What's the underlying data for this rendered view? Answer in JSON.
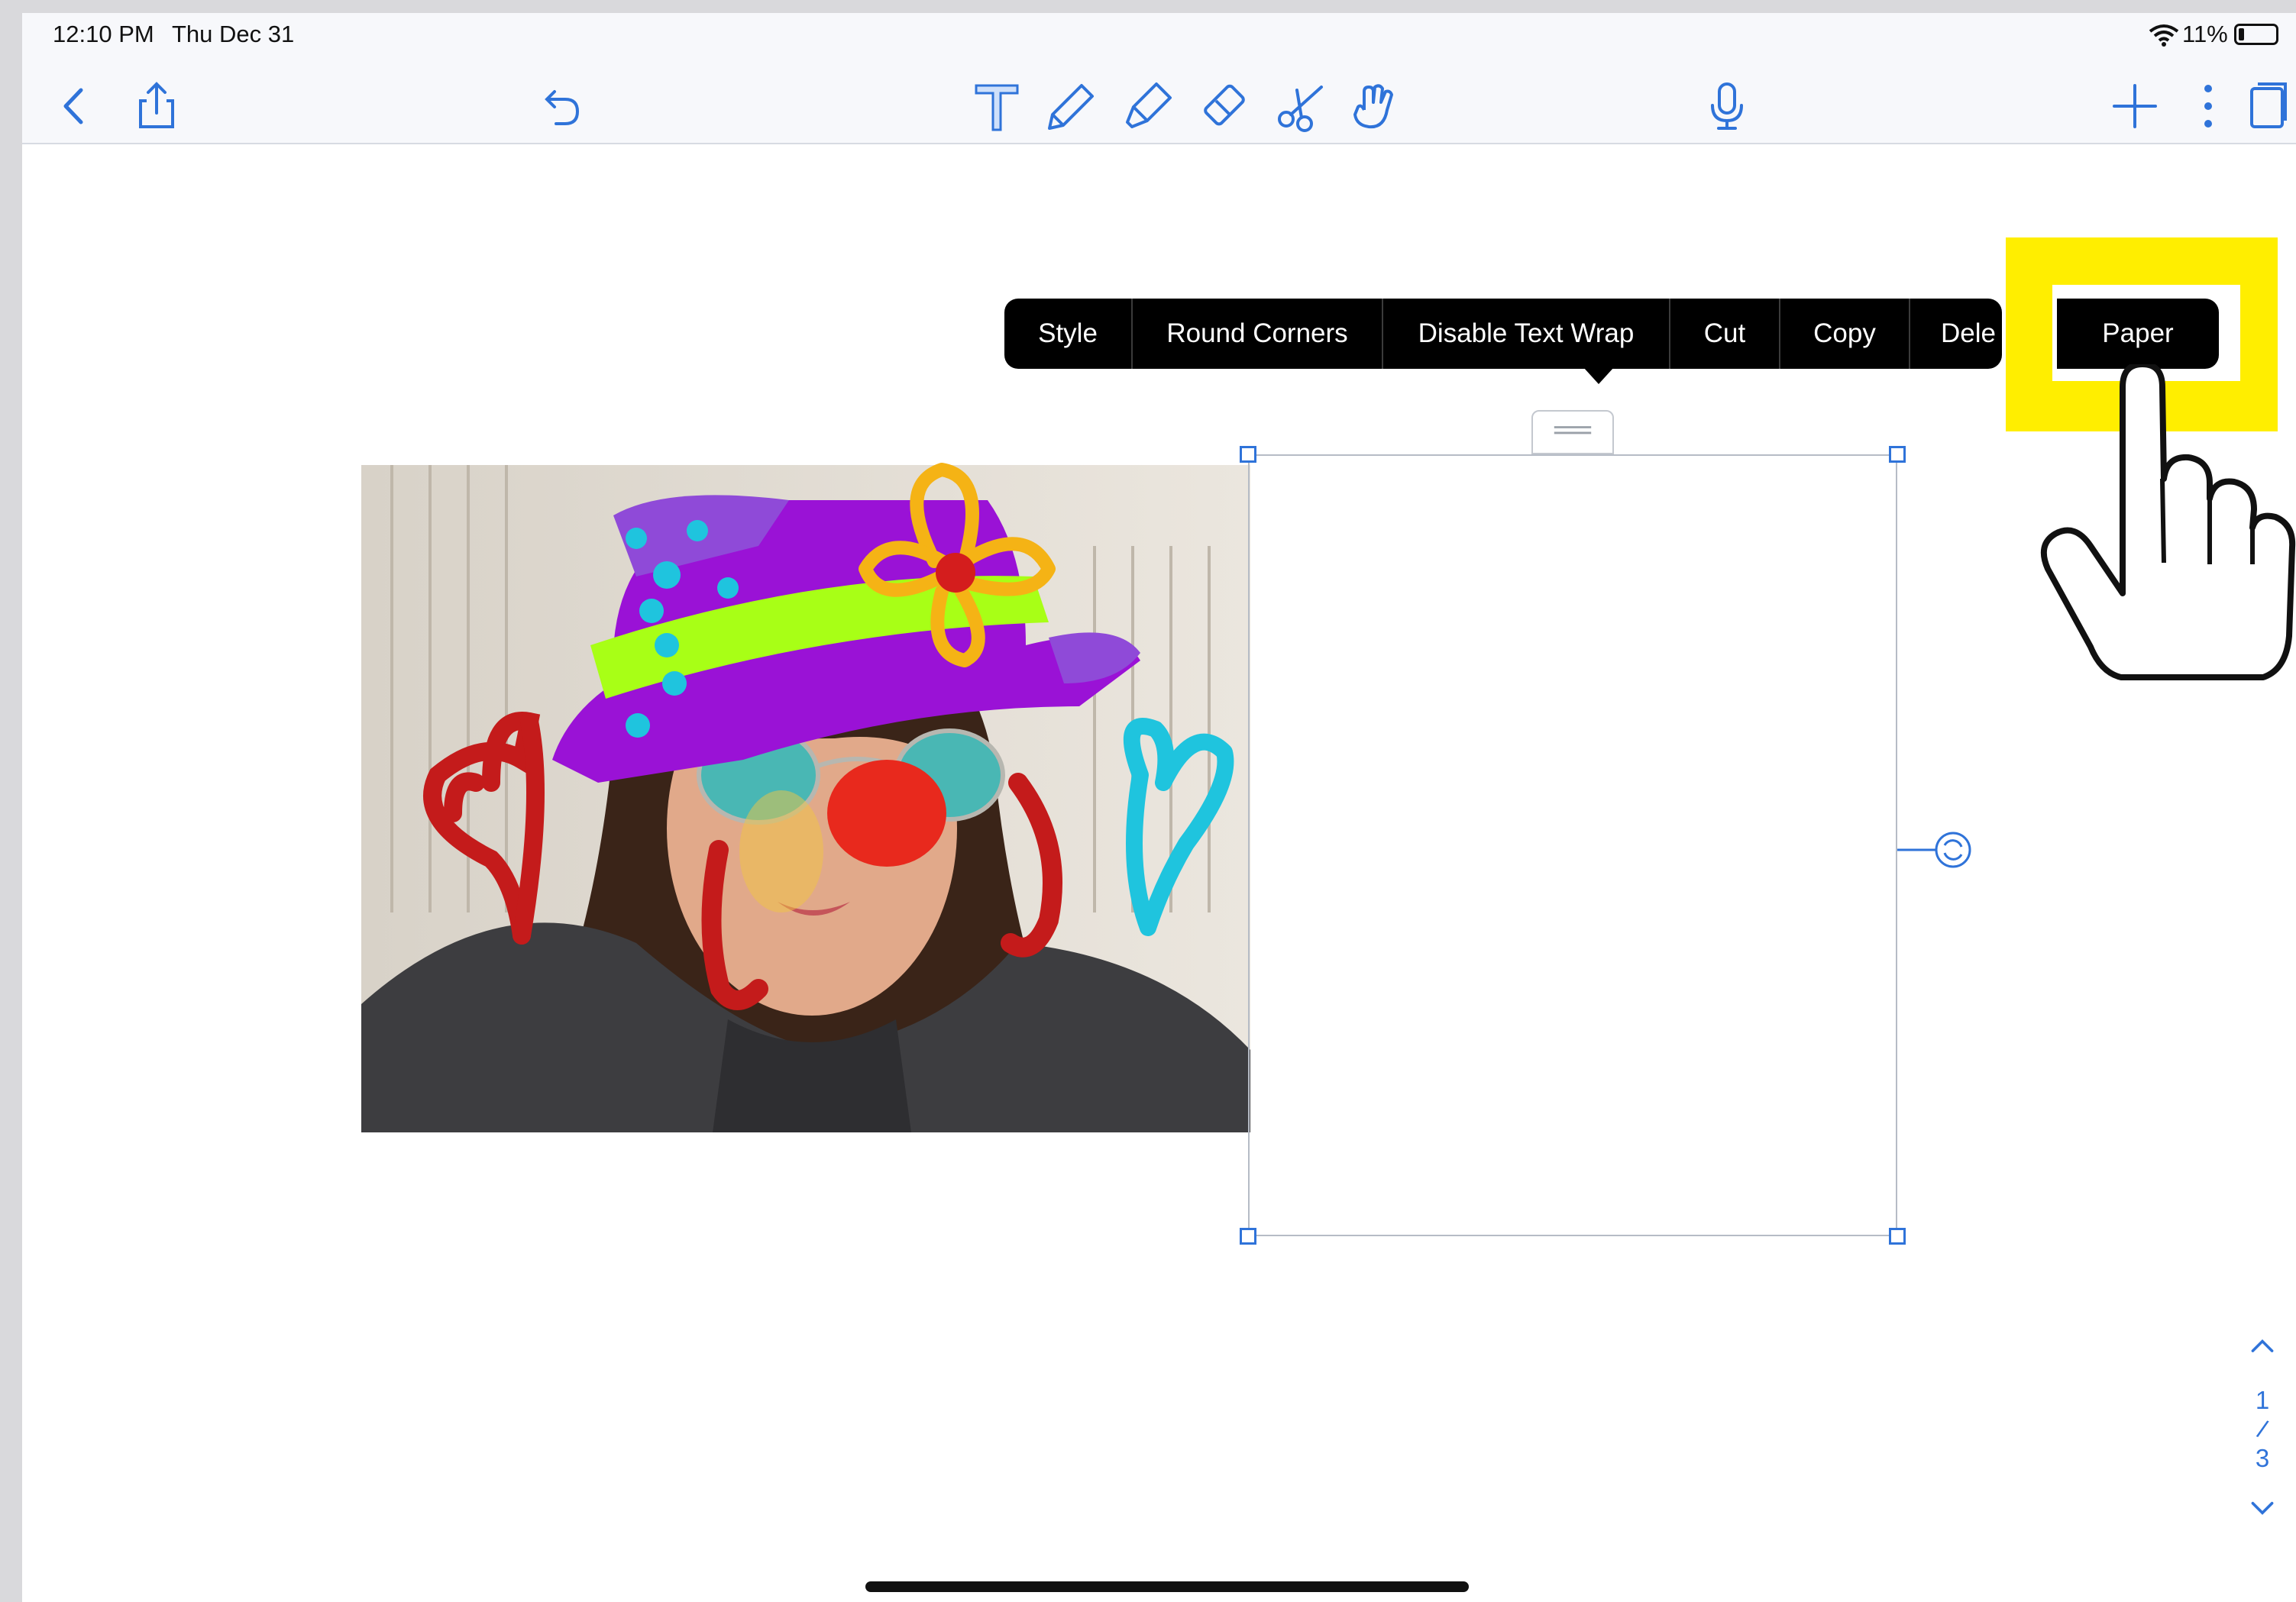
{
  "status_bar": {
    "time": "12:10 PM",
    "date": "Thu Dec 31",
    "battery": "11%"
  },
  "toolbar": {
    "icons": [
      "back-icon",
      "share-icon",
      "undo-icon",
      "text-tool-icon",
      "pen-icon",
      "highlighter-icon",
      "eraser-icon",
      "scissors-icon",
      "hand-icon",
      "microphone-icon",
      "add-icon",
      "more-icon",
      "pages-icon"
    ]
  },
  "context_menu": {
    "items": [
      "Style",
      "Round Corners",
      "Disable Text Wrap",
      "Cut",
      "Copy",
      "Dele",
      "Paper"
    ]
  },
  "page_indicator": {
    "current": "1",
    "separator": "/",
    "total": "3"
  },
  "colors": {
    "accent": "#2f73d9",
    "highlight": "#ffee00",
    "menu_bg": "#000000"
  }
}
